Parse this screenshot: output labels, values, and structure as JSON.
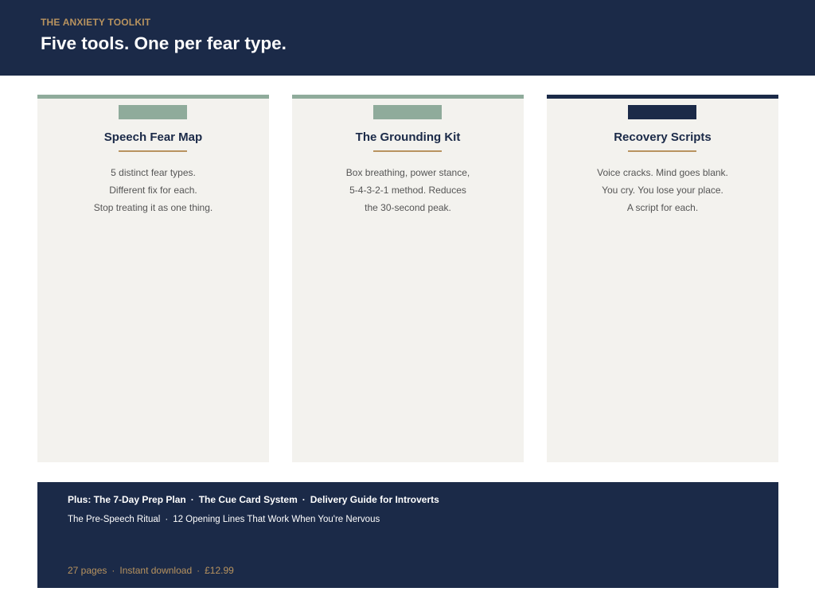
{
  "header": {
    "eyebrow": "THE ANXIETY TOOLKIT",
    "title": "Five tools. One per fear type."
  },
  "colors": {
    "navy": "#1b2a48",
    "sage": "#8fab9b",
    "gold": "#b8935f",
    "card_bg": "#f3f2ee"
  },
  "cards": [
    {
      "title": "Speech Fear Map",
      "accent": "#8fab9b",
      "lines": [
        "5 distinct fear types.",
        "Different fix for each.",
        "Stop treating it as one thing."
      ]
    },
    {
      "title": "The Grounding Kit",
      "accent": "#8fab9b",
      "lines": [
        "Box breathing, power stance,",
        "5-4-3-2-1 method. Reduces",
        "the 30-second peak."
      ]
    },
    {
      "title": "Recovery Scripts",
      "accent": "#1b2a48",
      "lines": [
        "Voice cracks. Mind goes blank.",
        "You cry. You lose your place.",
        "A script for each."
      ]
    }
  ],
  "footer": {
    "line1": [
      "Plus: The 7-Day Prep Plan",
      "The Cue Card System",
      "Delivery Guide for Introverts"
    ],
    "line2": [
      "The Pre-Speech Ritual",
      "12 Opening Lines That Work When You're Nervous"
    ],
    "line3": [
      "27 pages",
      "Instant download",
      "£12.99"
    ],
    "separator": "·"
  }
}
